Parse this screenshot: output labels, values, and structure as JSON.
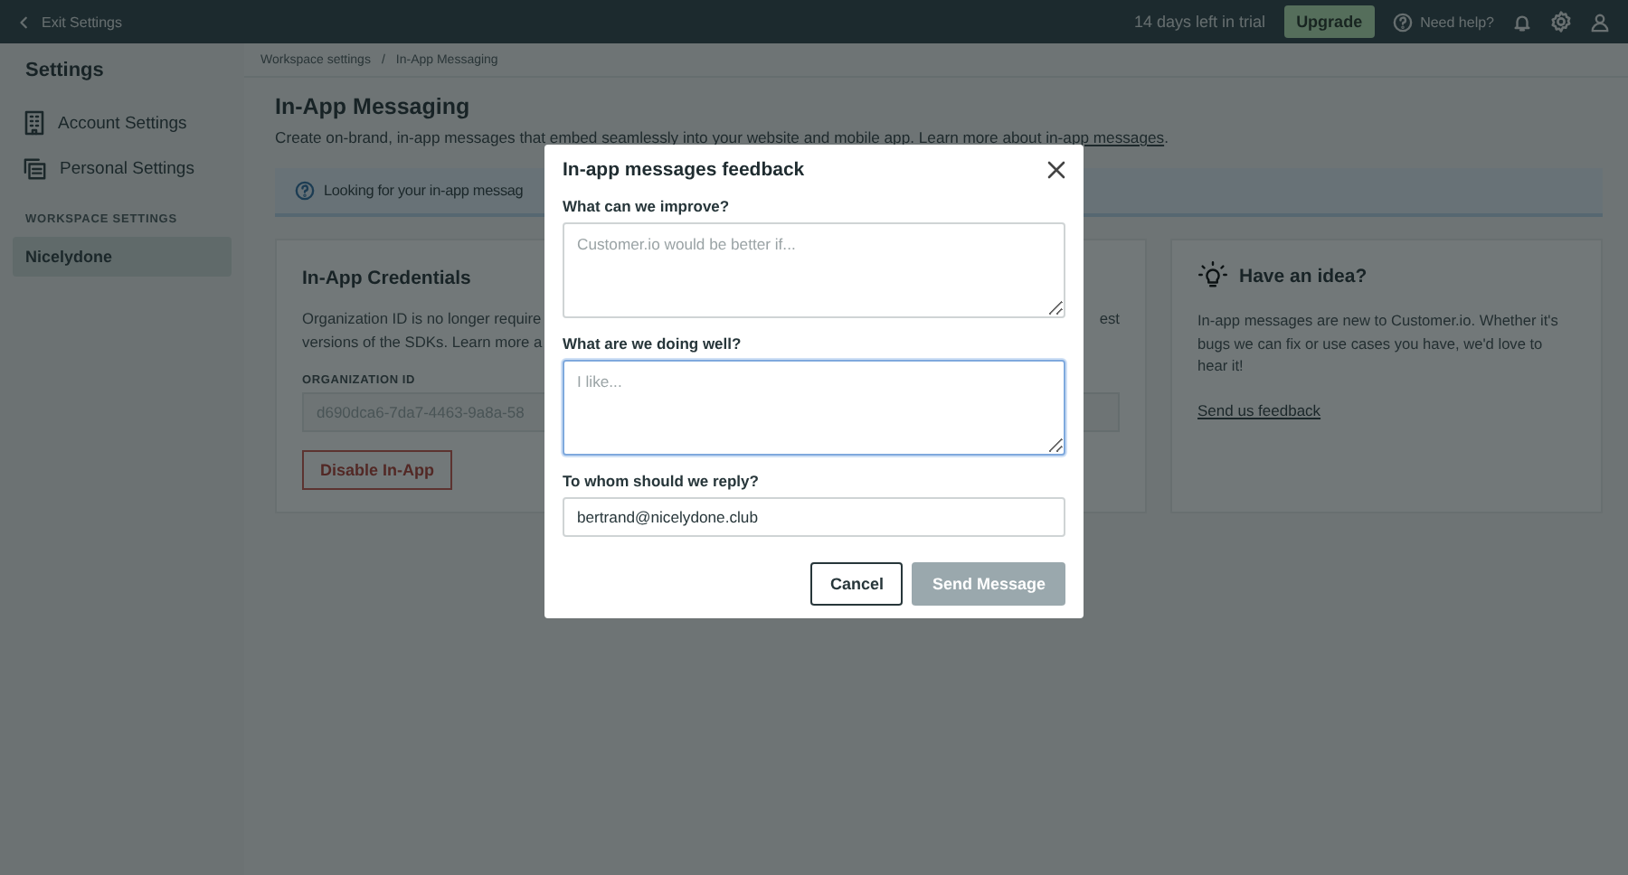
{
  "topbar": {
    "back": "Exit Settings",
    "trial": "14 days left in trial",
    "upgrade": "Upgrade",
    "help": "Need help?"
  },
  "sidebar": {
    "title": "Settings",
    "items": [
      {
        "label": "Account Settings"
      },
      {
        "label": "Personal Settings"
      }
    ],
    "section": "WORKSPACE SETTINGS",
    "workspaces": [
      {
        "label": "Nicelydone",
        "selected": true
      }
    ]
  },
  "breadcrumb": {
    "separator": "/",
    "items": [
      "Workspace settings",
      "In-App Messaging"
    ]
  },
  "page": {
    "title": "In-App Messaging",
    "description": "Create on-brand, in-app messages that embed seamlessly into your website and mobile app. Learn more about ",
    "link": "in-app messages",
    "after": "."
  },
  "banner": "Looking for your in-app messag",
  "credentials": {
    "title": "In-App Credentials",
    "lines": [
      {
        "left": "Organization ID is no longer require",
        "right": "est"
      },
      {
        "left": "versions of the SDKs. Learn more a"
      }
    ],
    "field_label": "ORGANIZATION ID",
    "field_value": "d690dca6-7da7-4463-9a8a-58",
    "button": "Disable In-App"
  },
  "idea": {
    "title": "Have an idea?",
    "text": "In-app messages are new to Customer.io. Whether it's bugs we can fix or use cases you have, we'd love to hear it!",
    "link": "Send us feedback"
  },
  "modal": {
    "title": "In-app messages feedback",
    "fields": [
      {
        "label": "What can we improve?",
        "kind": "textarea",
        "placeholder": "Customer.io would be better if...",
        "focused": false
      },
      {
        "label": "What are we doing well?",
        "kind": "textarea",
        "placeholder": "I like...",
        "focused": true
      },
      {
        "label": "To whom should we reply?",
        "kind": "input",
        "value": "bertrand@nicelydone.club",
        "focused": false
      }
    ],
    "buttons": [
      {
        "label": "Cancel",
        "disabled": false
      },
      {
        "label": "Send Message",
        "disabled": true
      }
    ]
  }
}
